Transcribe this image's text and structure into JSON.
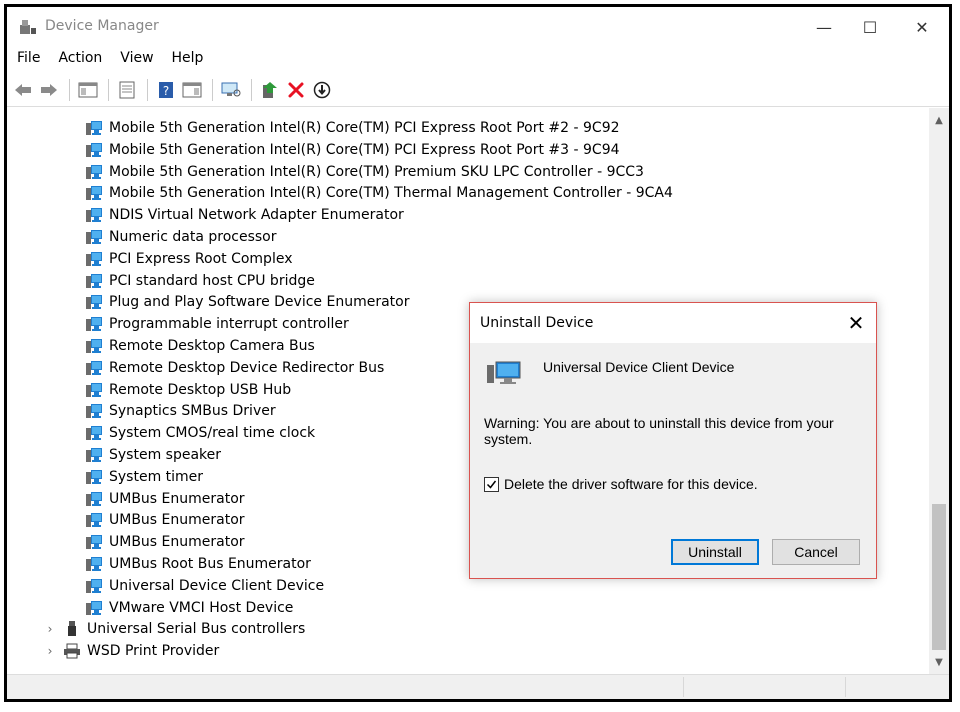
{
  "window": {
    "title": "Device Manager",
    "controls": {
      "minimize": "—",
      "maximize": "☐",
      "close": "✕"
    }
  },
  "menu": [
    "File",
    "Action",
    "View",
    "Help"
  ],
  "toolbar_icons": [
    "back-arrow-icon",
    "forward-arrow-icon",
    "show-hide-console-tree-icon",
    "properties-icon",
    "help-icon",
    "show-action-pane-icon",
    "scan-hardware-icon",
    "update-driver-icon",
    "uninstall-device-icon",
    "enable-device-icon"
  ],
  "tree": {
    "children": [
      "Mobile 5th Generation Intel(R) Core(TM) PCI Express Root Port #2 - 9C92",
      "Mobile 5th Generation Intel(R) Core(TM) PCI Express Root Port #3 - 9C94",
      "Mobile 5th Generation Intel(R) Core(TM) Premium SKU LPC Controller - 9CC3",
      "Mobile 5th Generation Intel(R) Core(TM) Thermal Management Controller - 9CA4",
      "NDIS Virtual Network Adapter Enumerator",
      "Numeric data processor",
      "PCI Express Root Complex",
      "PCI standard host CPU bridge",
      "Plug and Play Software Device Enumerator",
      "Programmable interrupt controller",
      "Remote Desktop Camera Bus",
      "Remote Desktop Device Redirector Bus",
      "Remote Desktop USB Hub",
      "Synaptics SMBus Driver",
      "System CMOS/real time clock",
      "System speaker",
      "System timer",
      "UMBus Enumerator",
      "UMBus Enumerator",
      "UMBus Enumerator",
      "UMBus Root Bus Enumerator",
      "Universal Device Client Device",
      "VMware VMCI Host Device"
    ],
    "categories": [
      {
        "label": "Universal Serial Bus controllers",
        "icon": "usb-icon"
      },
      {
        "label": "WSD Print Provider",
        "icon": "printer-icon"
      }
    ]
  },
  "dialog": {
    "title": "Uninstall Device",
    "close": "✕",
    "device_name": "Universal Device Client Device",
    "warning": "Warning: You are about to uninstall this device from your system.",
    "checkbox_label": "Delete the driver software for this device.",
    "checkbox_checked": true,
    "uninstall_label": "Uninstall",
    "cancel_label": "Cancel"
  },
  "colors": {
    "dialog_border": "#d9534f",
    "primary_button_border": "#0078d7",
    "uninstall_icon_red": "#e81123"
  }
}
